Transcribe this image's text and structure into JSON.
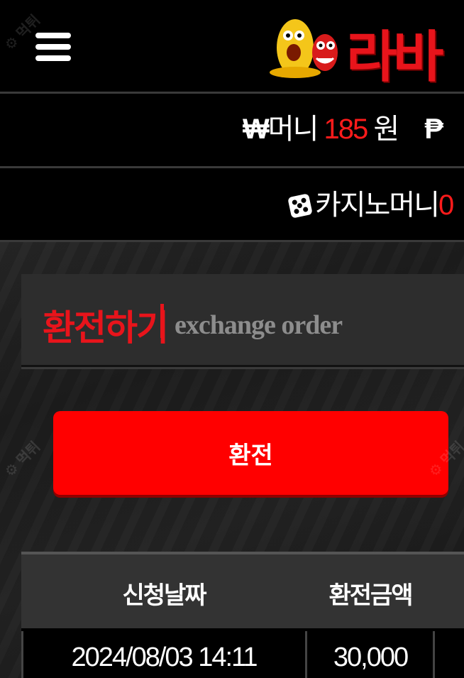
{
  "header": {
    "menu_icon": "hamburger-menu-icon",
    "logo_text": "라바"
  },
  "money": {
    "currency_symbol": "₩",
    "label": "머니",
    "amount": "185",
    "unit": "원",
    "point_symbol": "₱"
  },
  "casino": {
    "icon": "dice-icon",
    "label": "카지노머니",
    "amount": "0"
  },
  "exchange": {
    "title_ko": "환전하기",
    "title_en": "exchange order",
    "button_label": "환전"
  },
  "table": {
    "headers": [
      "신청날짜",
      "환전금액"
    ],
    "rows": [
      {
        "date": "2024/08/03 14:11",
        "amount": "30,000"
      }
    ]
  },
  "colors": {
    "accent": "#ff0000",
    "background": "#000000",
    "panel": "#2d2d2d"
  }
}
